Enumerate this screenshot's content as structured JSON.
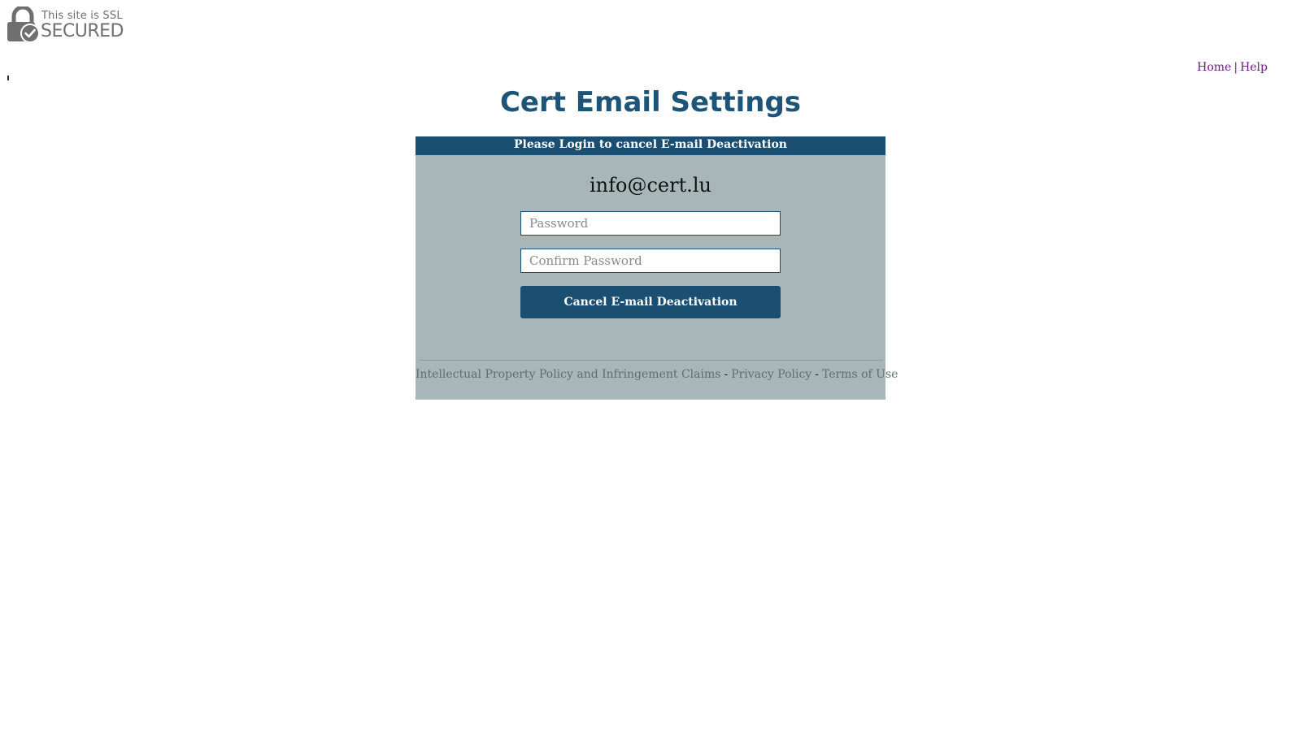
{
  "ssl_badge": {
    "line1": "This site is SSL",
    "line2": "SECURED",
    "icon": "padlock-check-icon",
    "color": "#6f6f6f"
  },
  "top_nav": {
    "home": "Home",
    "separator": "|",
    "help": "Help",
    "link_color": "#6a1b7e"
  },
  "page": {
    "title": "Cert Email Settings"
  },
  "login_panel": {
    "header": "Please Login to cancel E-mail Deactivation",
    "email": "info@cert.lu",
    "password_placeholder": "Password",
    "password_value": "",
    "confirm_placeholder": "Confirm Password",
    "confirm_value": "",
    "submit_label": "Cancel E-mail Deactivation",
    "accent_color": "#1b4f72",
    "panel_color": "#a8b5b9"
  },
  "footer": {
    "links": [
      "Intellectual Property Policy and Infringement Claims",
      "Privacy Policy",
      "Terms of Use"
    ],
    "separator": "-"
  }
}
